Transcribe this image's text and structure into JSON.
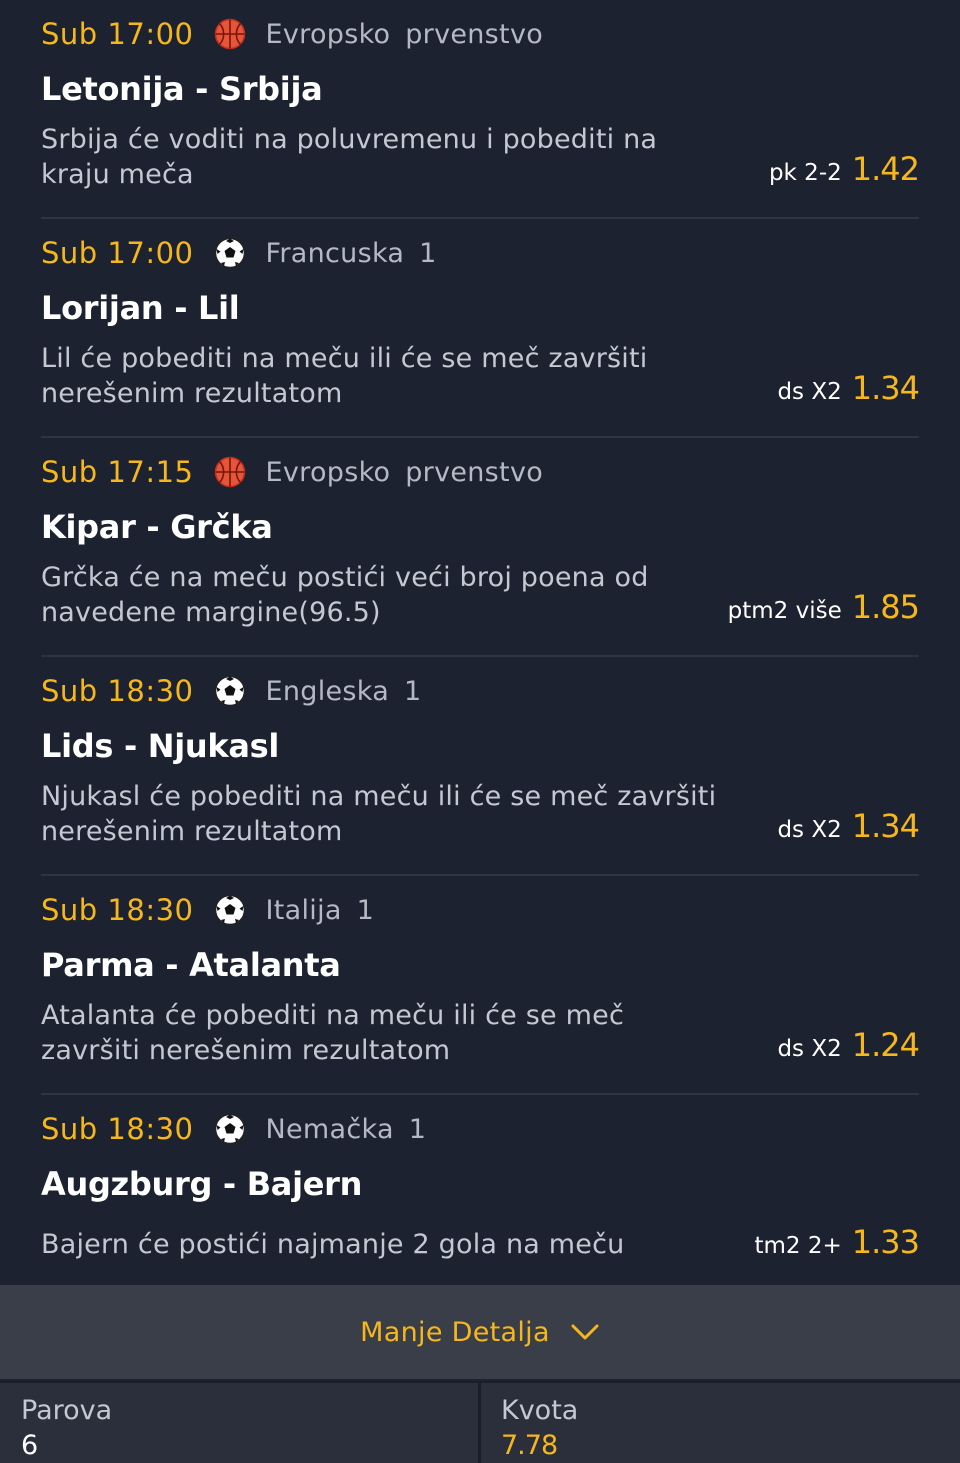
{
  "matches": [
    {
      "time": "Sub 17:00",
      "sport_icon": "basketball-icon",
      "league": "Evropsko prvenstvo",
      "teams": "Letonija - Srbija",
      "description": "Srbija će voditi na poluvremenu i pobediti na kraju meča",
      "pick_type": "pk 2-2",
      "odd": "1.42"
    },
    {
      "time": "Sub 17:00",
      "sport_icon": "soccer-ball-icon",
      "league": "Francuska 1",
      "teams": "Lorijan - Lil",
      "description": "Lil će pobediti na meču ili će se meč završiti nerešenim rezultatom",
      "pick_type": "ds X2",
      "odd": "1.34"
    },
    {
      "time": "Sub 17:15",
      "sport_icon": "basketball-icon",
      "league": "Evropsko prvenstvo",
      "teams": "Kipar - Grčka",
      "description": "Grčka će na meču postići veći broj poena od navedene margine(96.5)",
      "pick_type": "ptm2 više",
      "odd": "1.85"
    },
    {
      "time": "Sub 18:30",
      "sport_icon": "soccer-ball-icon",
      "league": "Engleska 1",
      "teams": "Lids - Njukasl",
      "description": "Njukasl će pobediti na meču ili će se meč završiti nerešenim rezultatom",
      "pick_type": "ds X2",
      "odd": "1.34"
    },
    {
      "time": "Sub 18:30",
      "sport_icon": "soccer-ball-icon",
      "league": "Italija 1",
      "teams": "Parma - Atalanta",
      "description": "Atalanta će pobediti na meču ili će se meč završiti nerešenim rezultatom",
      "pick_type": "ds X2",
      "odd": "1.24"
    },
    {
      "time": "Sub 18:30",
      "sport_icon": "soccer-ball-icon",
      "league": "Nemačka 1",
      "teams": "Augzburg - Bajern",
      "description": "Bajern će postići najmanje 2 gola na meču",
      "pick_type": "tm2 2+",
      "odd": "1.33"
    }
  ],
  "toggle": {
    "label": "Manje Detalja",
    "icon": "chevron-down-icon"
  },
  "footer": {
    "pairs_label": "Parova",
    "pairs_value": "6",
    "odds_label": "Kvota",
    "odds_value": "7.78"
  },
  "colors": {
    "background": "#1d2230",
    "accent": "#f5b71c",
    "muted_text": "#c4c8d1",
    "separator": "#2e3444"
  }
}
